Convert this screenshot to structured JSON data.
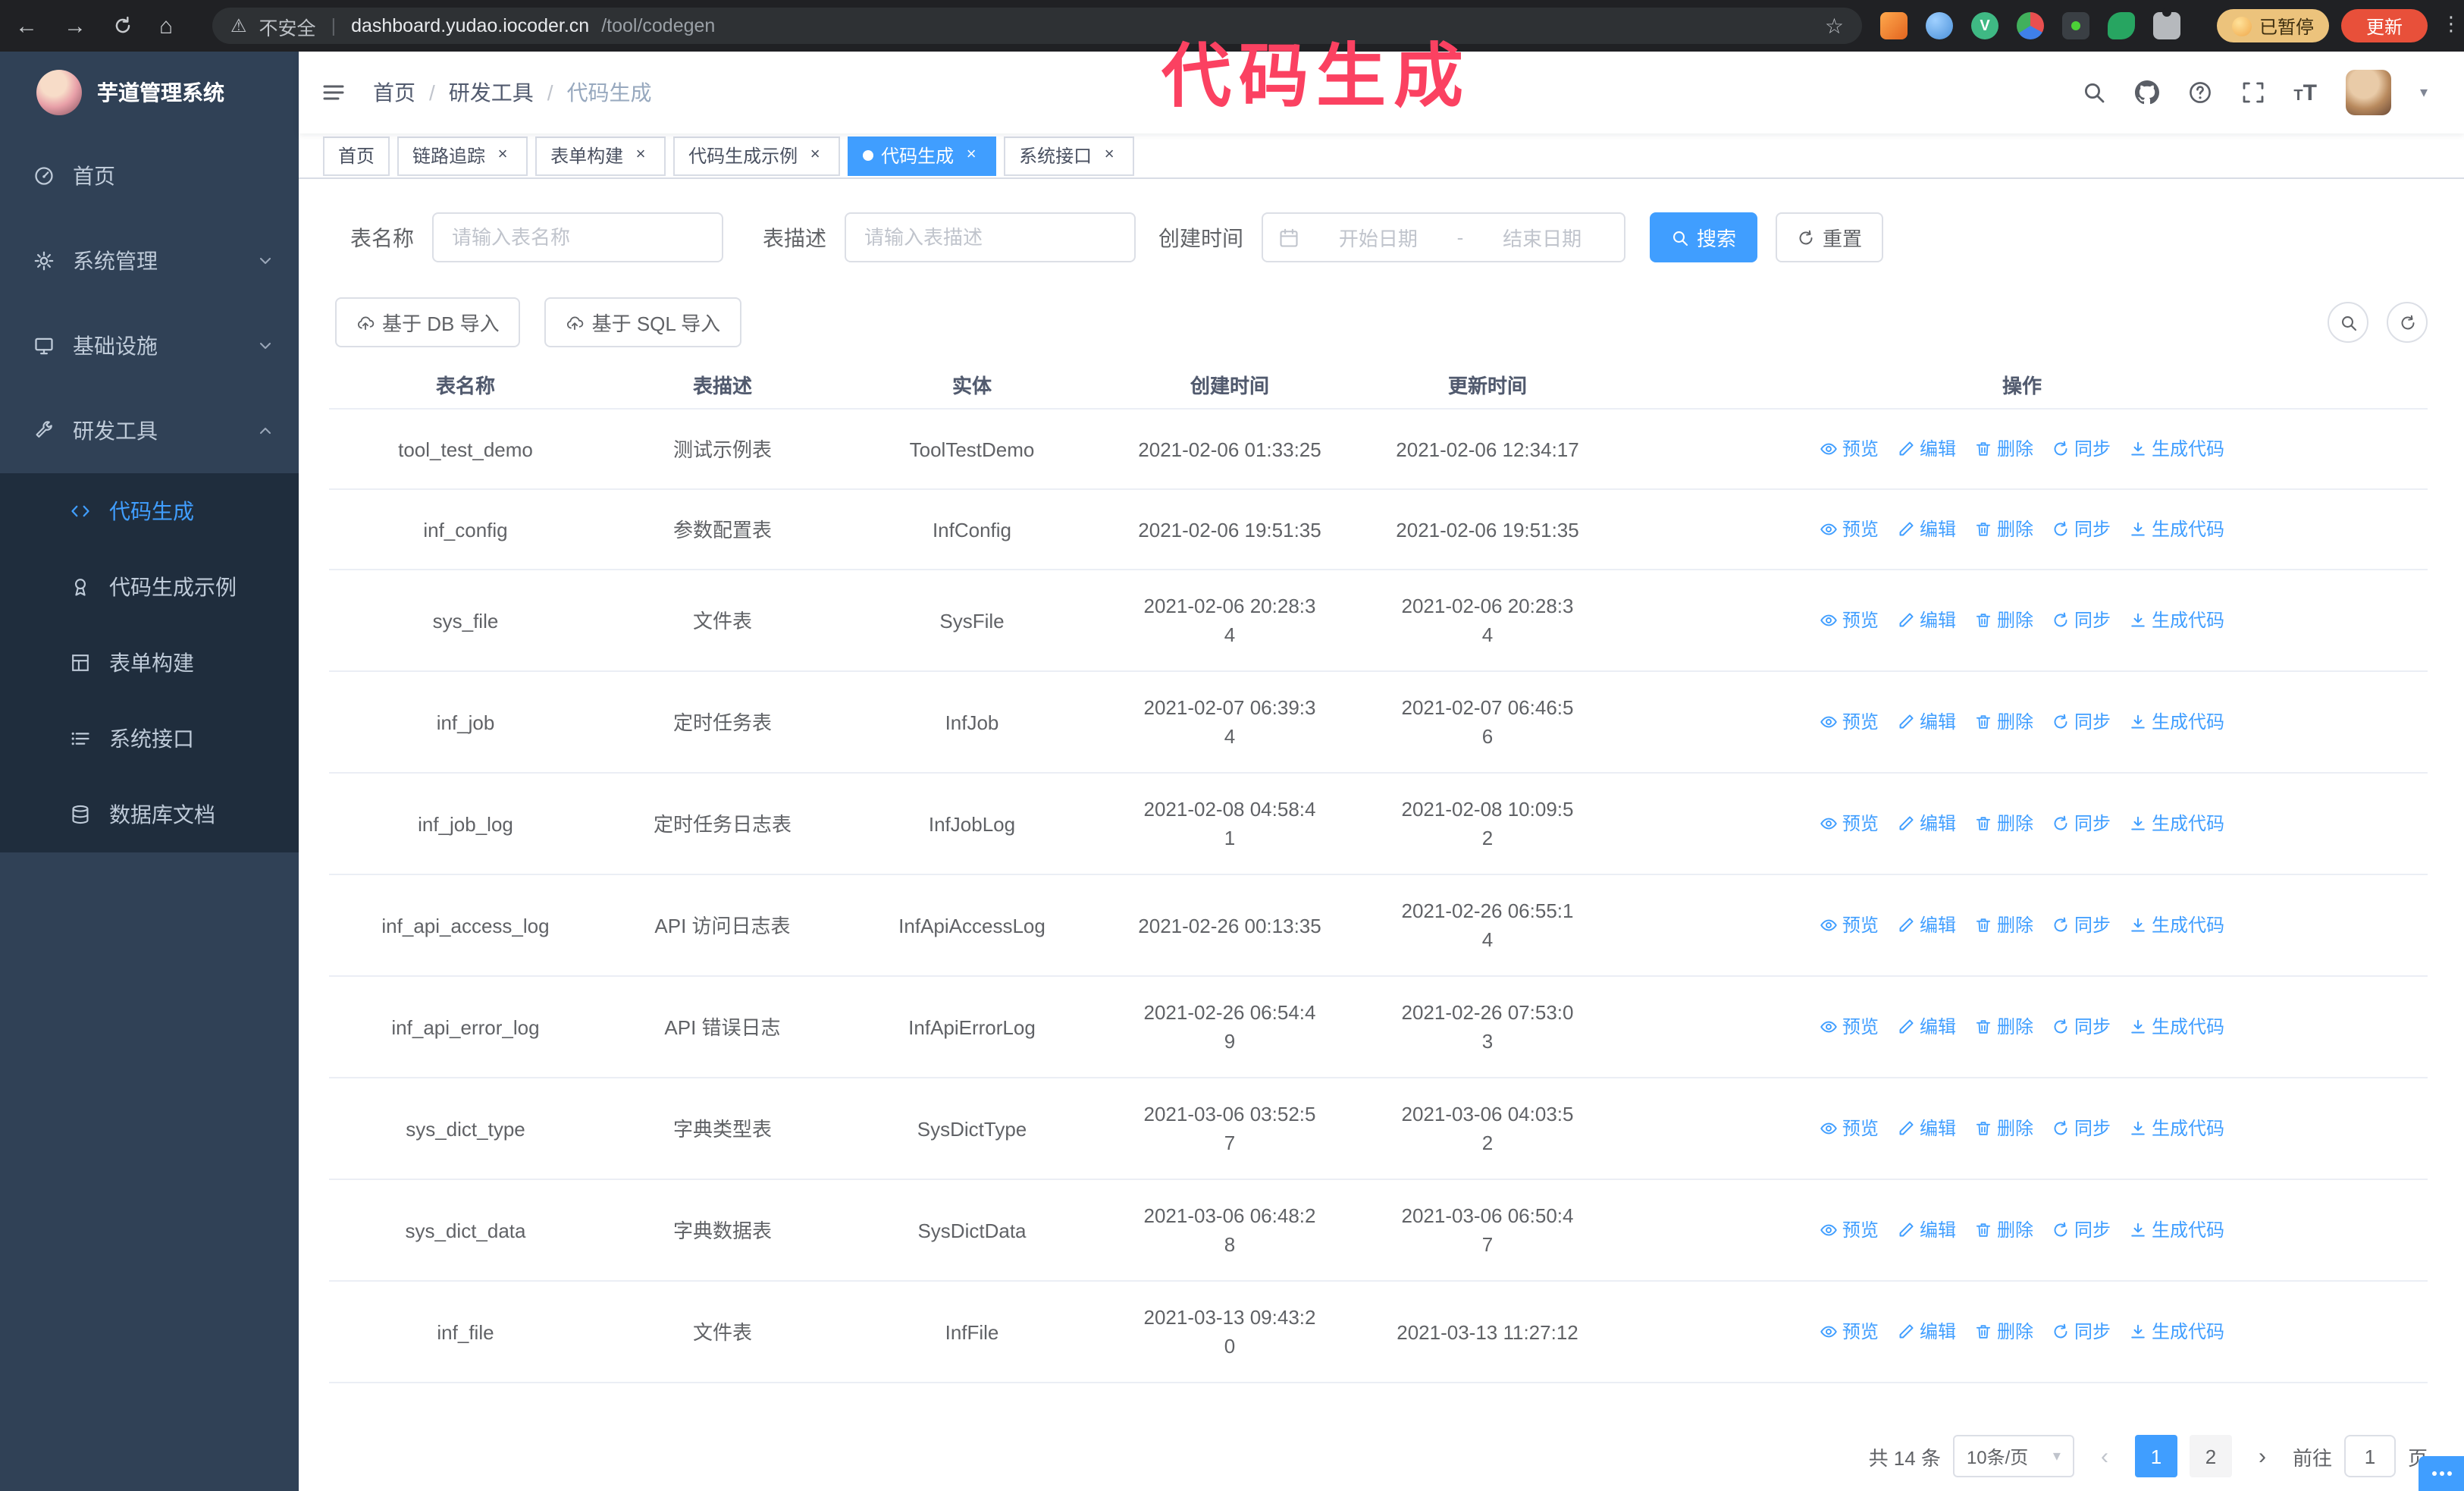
{
  "colors": {
    "accent": "#409eff",
    "sidebar_bg": "#304156",
    "submenu_bg": "#1f2d3d",
    "annotation": "#fb4161",
    "update_button_bg": "#e8503a",
    "paused_badge_bg": "#ecc37c"
  },
  "browser": {
    "security_label": "不安全",
    "url_host": "dashboard.yudao.iocoder.cn",
    "url_path": "/tool/codegen",
    "paused_badge_label": "已暂停",
    "update_button_label": "更新"
  },
  "annotation": {
    "text": "代码生成"
  },
  "sidebar": {
    "logo_title": "芋道管理系统",
    "items": [
      {
        "label": "首页"
      },
      {
        "label": "系统管理"
      },
      {
        "label": "基础设施"
      },
      {
        "label": "研发工具"
      }
    ],
    "submenu": [
      {
        "label": "代码生成"
      },
      {
        "label": "代码生成示例"
      },
      {
        "label": "表单构建"
      },
      {
        "label": "系统接口"
      },
      {
        "label": "数据库文档"
      }
    ]
  },
  "header": {
    "breadcrumb": [
      "首页",
      "研发工具",
      "代码生成"
    ]
  },
  "tabs": [
    {
      "label": "首页"
    },
    {
      "label": "链路追踪"
    },
    {
      "label": "表单构建"
    },
    {
      "label": "代码生成示例"
    },
    {
      "label": "代码生成"
    },
    {
      "label": "系统接口"
    }
  ],
  "filters": {
    "table_name_label": "表名称",
    "table_name_placeholder": "请输入表名称",
    "table_desc_label": "表描述",
    "table_desc_placeholder": "请输入表描述",
    "create_time_label": "创建时间",
    "date_start_placeholder": "开始日期",
    "date_separator": "-",
    "date_end_placeholder": "结束日期",
    "search_button": "搜索",
    "reset_button": "重置"
  },
  "toolbar": {
    "import_db_button": "基于 DB 导入",
    "import_sql_button": "基于 SQL 导入"
  },
  "table": {
    "columns": [
      "表名称",
      "表描述",
      "实体",
      "创建时间",
      "更新时间",
      "操作"
    ],
    "action_labels": [
      "预览",
      "编辑",
      "删除",
      "同步",
      "生成代码"
    ],
    "rows": [
      {
        "name": "tool_test_demo",
        "desc": "测试示例表",
        "entity": "ToolTestDemo",
        "created": "2021-02-06 01:33:25",
        "updated": "2021-02-06 12:34:17"
      },
      {
        "name": "inf_config",
        "desc": "参数配置表",
        "entity": "InfConfig",
        "created": "2021-02-06 19:51:35",
        "updated": "2021-02-06 19:51:35"
      },
      {
        "name": "sys_file",
        "desc": "文件表",
        "entity": "SysFile",
        "created": "2021-02-06 20:28:3\n4",
        "updated": "2021-02-06 20:28:3\n4"
      },
      {
        "name": "inf_job",
        "desc": "定时任务表",
        "entity": "InfJob",
        "created": "2021-02-07 06:39:3\n4",
        "updated": "2021-02-07 06:46:5\n6"
      },
      {
        "name": "inf_job_log",
        "desc": "定时任务日志表",
        "entity": "InfJobLog",
        "created": "2021-02-08 04:58:4\n1",
        "updated": "2021-02-08 10:09:5\n2"
      },
      {
        "name": "inf_api_access_log",
        "desc": "API 访问日志表",
        "entity": "InfApiAccessLog",
        "created": "2021-02-26 00:13:35",
        "updated": "2021-02-26 06:55:1\n4"
      },
      {
        "name": "inf_api_error_log",
        "desc": "API 错误日志",
        "entity": "InfApiErrorLog",
        "created": "2021-02-26 06:54:4\n9",
        "updated": "2021-02-26 07:53:0\n3"
      },
      {
        "name": "sys_dict_type",
        "desc": "字典类型表",
        "entity": "SysDictType",
        "created": "2021-03-06 03:52:5\n7",
        "updated": "2021-03-06 04:03:5\n2"
      },
      {
        "name": "sys_dict_data",
        "desc": "字典数据表",
        "entity": "SysDictData",
        "created": "2021-03-06 06:48:2\n8",
        "updated": "2021-03-06 06:50:4\n7"
      },
      {
        "name": "inf_file",
        "desc": "文件表",
        "entity": "InfFile",
        "created": "2021-03-13 09:43:2\n0",
        "updated": "2021-03-13 11:27:12"
      }
    ]
  },
  "pagination": {
    "total_text": "共 14 条",
    "page_size": "10条/页",
    "pages": [
      "1",
      "2"
    ],
    "goto_label": "前往",
    "goto_value": "1",
    "goto_suffix": "页"
  }
}
